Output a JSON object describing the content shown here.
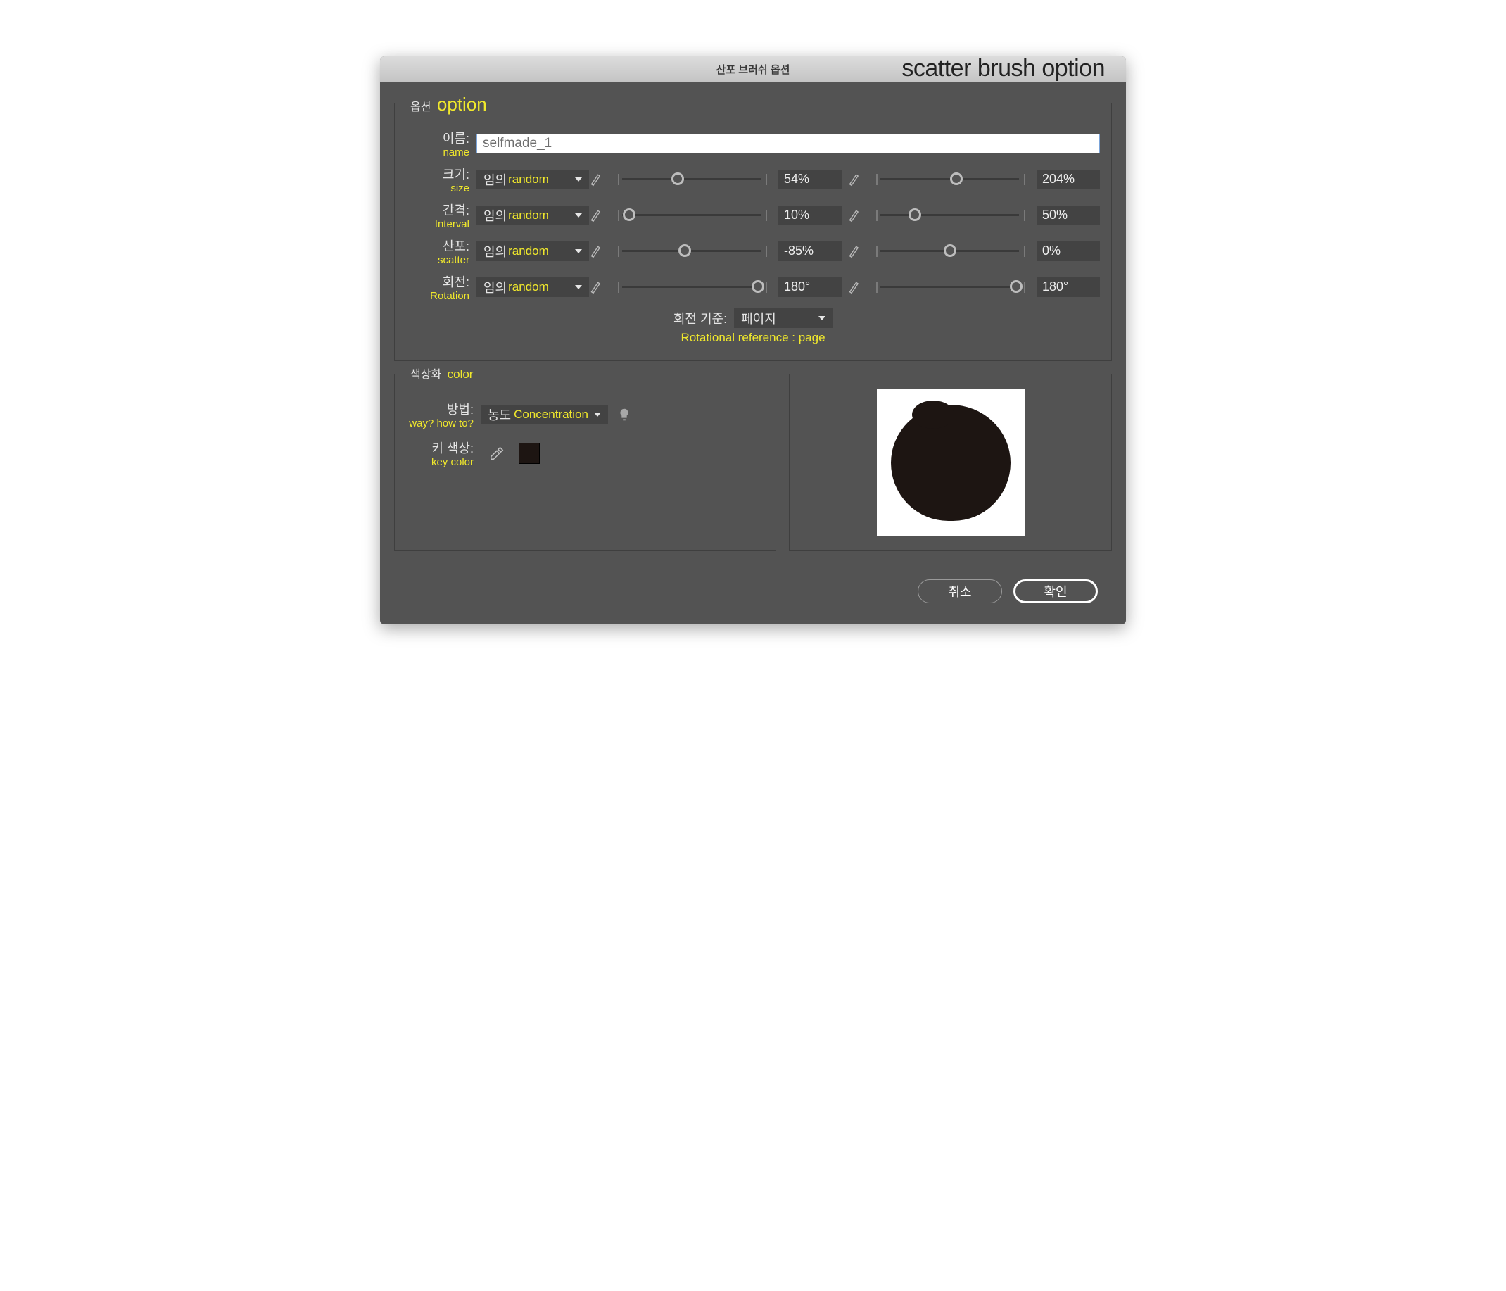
{
  "title": {
    "ko": "산포 브러쉬 옵션",
    "en": "scatter brush option"
  },
  "options_legend": {
    "ko": "옵션",
    "en": "option"
  },
  "name": {
    "label_ko": "이름:",
    "label_en": "name",
    "value": "selfmade_1"
  },
  "modes": {
    "random_ko": "임의",
    "random_en": "random"
  },
  "rows": {
    "size": {
      "label_ko": "크기:",
      "label_en": "size",
      "v1": "54%",
      "p1": 40,
      "v2": "204%",
      "p2": 55
    },
    "interval": {
      "label_ko": "간격:",
      "label_en": "Interval",
      "v1": "10%",
      "p1": 5,
      "v2": "50%",
      "p2": 25
    },
    "scatter": {
      "label_ko": "산포:",
      "label_en": "scatter",
      "v1": "-85%",
      "p1": 45,
      "v2": "0%",
      "p2": 50
    },
    "rotation": {
      "label_ko": "회전:",
      "label_en": "Rotation",
      "v1": "180°",
      "p1": 98,
      "v2": "180°",
      "p2": 98
    }
  },
  "rot_ref": {
    "label_ko": "회전 기준:",
    "value_ko": "페이지",
    "label_en": "Rotational reference : page"
  },
  "color_legend": {
    "ko": "색상화",
    "en": "color"
  },
  "method": {
    "label_ko": "방법:",
    "label_en": "way? how to?",
    "value_ko": "농도",
    "value_en": "Concentration"
  },
  "key_color": {
    "label_ko": "키 색상:",
    "label_en": "key color",
    "value": "#1d1512"
  },
  "buttons": {
    "cancel": "취소",
    "ok": "확인"
  }
}
